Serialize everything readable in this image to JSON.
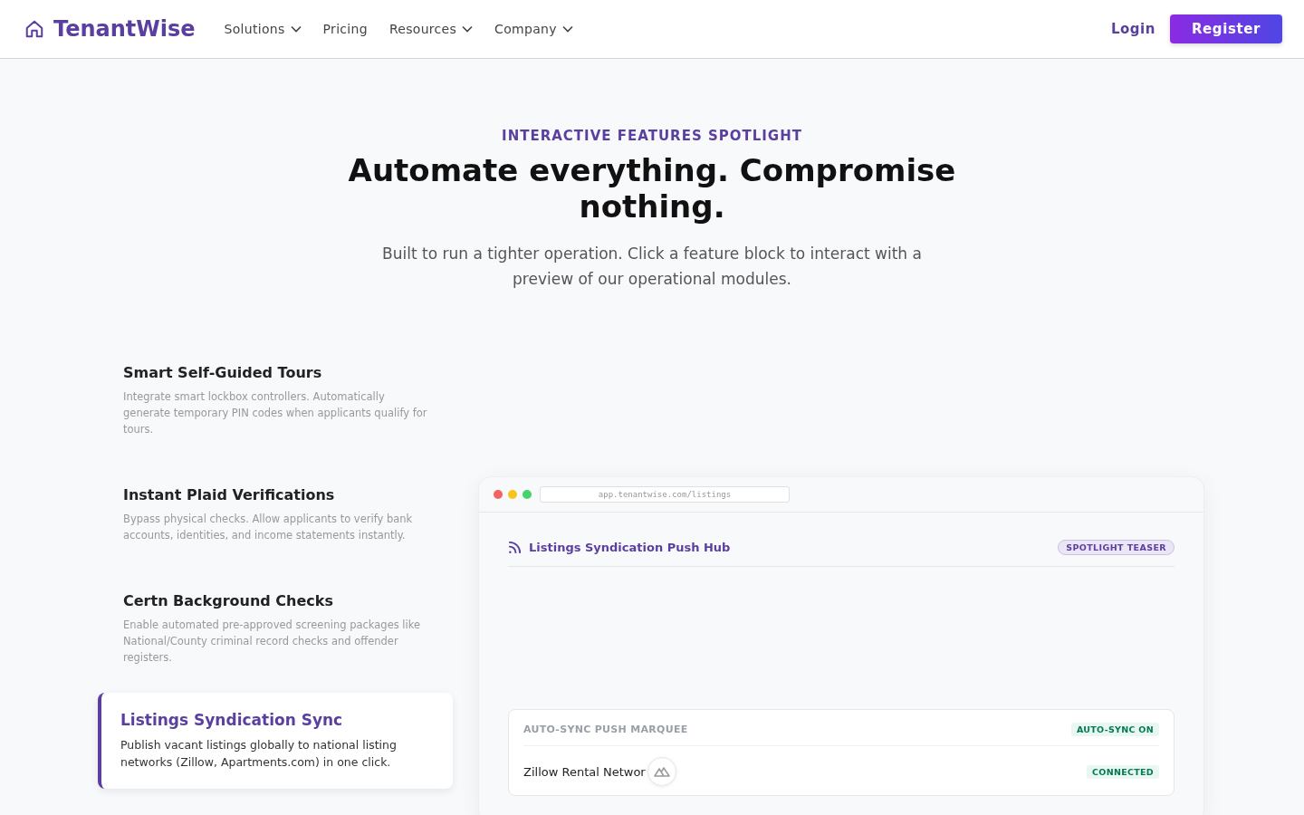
{
  "nav": {
    "brand": "TenantWise",
    "links": [
      {
        "label": "Solutions",
        "dropdown": true
      },
      {
        "label": "Pricing",
        "dropdown": false
      },
      {
        "label": "Resources",
        "dropdown": true
      },
      {
        "label": "Company",
        "dropdown": true
      }
    ],
    "login": "Login",
    "register": "Register"
  },
  "hero": {
    "eyebrow": "INTERACTIVE FEATURES SPOTLIGHT",
    "title": "Automate everything. Compromise nothing.",
    "subtitle": "Built to run a tighter operation. Click a feature block to interact with a preview of our operational modules."
  },
  "features": [
    {
      "title": "Smart Self-Guided Tours",
      "description": "Integrate smart lockbox controllers. Automatically generate temporary PIN codes when applicants qualify for tours.",
      "selected": false
    },
    {
      "title": "Instant Plaid Verifications",
      "description": "Bypass physical checks. Allow applicants to verify bank accounts, identities, and income statements instantly.",
      "selected": false
    },
    {
      "title": "Certn Background Checks",
      "description": "Enable automated pre-approved screening packages like National/County criminal record checks and offender registers.",
      "selected": false
    },
    {
      "title": "Listings Syndication Sync",
      "description": "Publish vacant listings globally to national listing networks (Zillow, Apartments.com) in one click.",
      "selected": true
    }
  ],
  "preview": {
    "url": "app.tenantwise.com/listings",
    "title": "Listings Syndication Push Hub",
    "badge": "SPOTLIGHT TEASER",
    "panel": {
      "title": "AUTO-SYNC PUSH MARQUEE",
      "status": "AUTO-SYNC ON",
      "rows": [
        {
          "name": "Zillow Rental Networ",
          "status": "CONNECTED"
        }
      ]
    }
  }
}
